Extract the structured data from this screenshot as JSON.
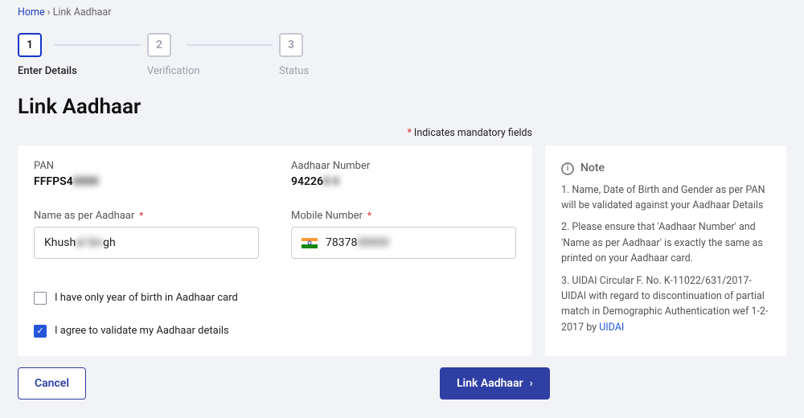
{
  "breadcrumb": {
    "home": "Home",
    "current": "Link Aadhaar"
  },
  "steps": {
    "s1": {
      "num": "1",
      "label": "Enter Details"
    },
    "s2": {
      "num": "2",
      "label": "Verification"
    },
    "s3": {
      "num": "3",
      "label": "Status"
    }
  },
  "title": "Link Aadhaar",
  "mandatory_note_prefix": "* ",
  "mandatory_note": "Indicates mandatory fields",
  "fields": {
    "pan_label": "PAN",
    "pan_value_visible": "FFFPS4",
    "pan_value_hidden": "0000",
    "aadhaar_label": "Aadhaar Number",
    "aadhaar_value_visible1": "94226",
    "aadhaar_value_hidden": "0  4",
    "aadhaar_value_visible2": "",
    "name_label": "Name as per Aadhaar",
    "name_value_visible1": "Khush",
    "name_value_hidden": "al Sin",
    "name_value_visible2": "gh",
    "mobile_label": "Mobile Number",
    "mobile_value_visible": "78378",
    "mobile_value_hidden": "00000"
  },
  "checkboxes": {
    "yob_only": "I have only year of birth in Aadhaar card",
    "agree": "I agree to validate my Aadhaar details"
  },
  "note": {
    "title": "Note",
    "p1": "1. Name, Date of Birth and Gender as per PAN will be validated against your Aadhaar Details",
    "p2": "2. Please ensure that 'Aadhaar Number' and 'Name as per Aadhaar' is exactly the same as printed on your Aadhaar card.",
    "p3": "3. UIDAI Circular F. No. K-11022/631/2017-UIDAI with regard to discontinuation of partial match in Demographic Authentication wef 1-2-2017 by ",
    "p3_link": "UIDAI"
  },
  "actions": {
    "cancel": "Cancel",
    "link": "Link Aadhaar"
  }
}
